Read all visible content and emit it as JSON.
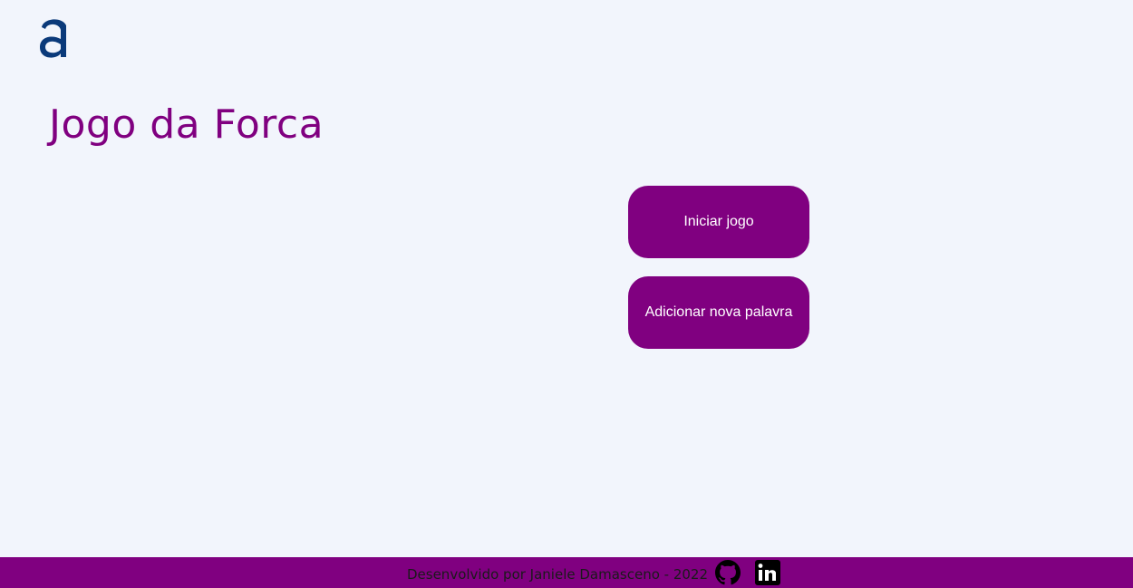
{
  "header": {
    "logo_icon": "alura-logo-icon",
    "logo_color": "#0b3a7a"
  },
  "main": {
    "title": "Jogo da Forca",
    "title_color": "#800080",
    "buttons": {
      "start_label": "Iniciar jogo",
      "add_word_label": "Adicionar nova palavra"
    },
    "accent_color": "#800080"
  },
  "footer": {
    "text": "Desenvolvido por Janiele Damasceno - 2022",
    "github_icon": "github-icon",
    "linkedin_icon": "linkedin-icon",
    "background_color": "#800080"
  }
}
